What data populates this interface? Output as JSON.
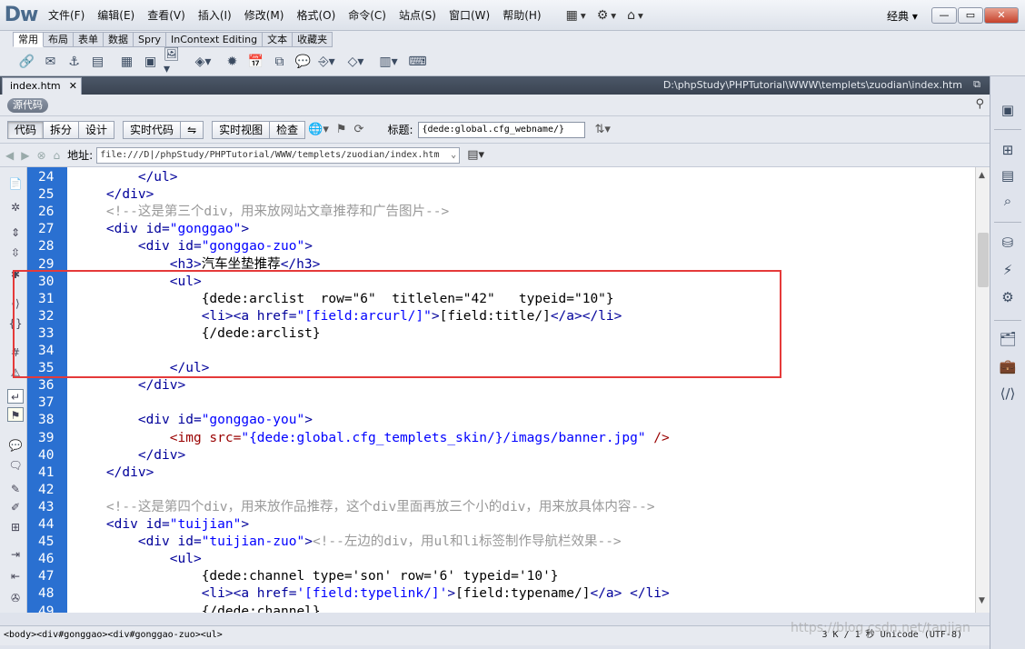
{
  "app": {
    "logo": "Dw",
    "layout": "经典 ▾"
  },
  "menu": [
    "文件(F)",
    "编辑(E)",
    "查看(V)",
    "插入(I)",
    "修改(M)",
    "格式(O)",
    "命令(C)",
    "站点(S)",
    "窗口(W)",
    "帮助(H)"
  ],
  "insert_tabs": [
    "常用",
    "布局",
    "表单",
    "数据",
    "Spry",
    "InContext Editing",
    "文本",
    "收藏夹"
  ],
  "document": {
    "tab": "index.htm",
    "path": "D:\\phpStudy\\PHPTutorial\\WWW\\templets\\zuodian\\index.htm",
    "source_label": "源代码"
  },
  "doc_toolbar": {
    "code": "代码",
    "split": "拆分",
    "design": "设计",
    "live_code": "实时代码",
    "live_view": "实时视图",
    "inspect": "检查",
    "title_label": "标题:",
    "title_value": "{dede:global.cfg_webname/}"
  },
  "address": {
    "label": "地址:",
    "value": "file:///D|/phpStudy/PHPTutorial/WWW/templets/zuodian/index.htm"
  },
  "code_lines": [
    {
      "n": "24",
      "html": "        <span class='tag'>&lt;/ul&gt;</span>"
    },
    {
      "n": "25",
      "html": "    <span class='tag'>&lt;/div&gt;</span>"
    },
    {
      "n": "26",
      "html": "    <span class='cm'>&lt;!--这是第三个div，用来放网站文章推荐和广告图片--&gt;</span>"
    },
    {
      "n": "27",
      "html": "    <span class='tag'>&lt;div </span><span class='att'>id=</span><span class='val'>\"gonggao\"</span><span class='tag'>&gt;</span>"
    },
    {
      "n": "28",
      "html": "        <span class='tag'>&lt;div </span><span class='att'>id=</span><span class='val'>\"gonggao-zuo\"</span><span class='tag'>&gt;</span>"
    },
    {
      "n": "29",
      "html": "            <span class='tag'>&lt;h3&gt;</span><span class='txt'>汽车坐垫推荐</span><span class='tag'>&lt;/h3&gt;</span>"
    },
    {
      "n": "30",
      "html": "            <span class='tag'>&lt;ul&gt;</span>"
    },
    {
      "n": "31",
      "html": "                <span class='txt'>{dede:arclist  row=\"6\"  titlelen=\"42\"   typeid=\"10\"}</span>"
    },
    {
      "n": "32",
      "html": "                <span class='tag'>&lt;li&gt;&lt;a </span><span class='att'>href=</span><span class='val'>\"[field:arcurl/]\"</span><span class='tag'>&gt;</span><span class='txt'>[field:title/]</span><span class='tag'>&lt;/a&gt;&lt;/li&gt;</span>"
    },
    {
      "n": "33",
      "html": "                <span class='txt'>{/dede:arclist}</span>"
    },
    {
      "n": "34",
      "html": ""
    },
    {
      "n": "35",
      "html": "            <span class='tag'>&lt;/ul&gt;</span>"
    },
    {
      "n": "36",
      "html": "        <span class='tag'>&lt;/div&gt;</span>"
    },
    {
      "n": "37",
      "html": ""
    },
    {
      "n": "38",
      "html": "        <span class='tag'>&lt;div </span><span class='att'>id=</span><span class='val'>\"gonggao-you\"</span><span class='tag'>&gt;</span>"
    },
    {
      "n": "39",
      "html": "            <span class='tag' style='color:#990000'>&lt;img </span><span class='att' style='color:#990000'>src=</span><span class='val'>\"{dede:global.cfg_templets_skin/}/imags/banner.jpg\"</span><span class='tag' style='color:#990000'> /&gt;</span>"
    },
    {
      "n": "40",
      "html": "        <span class='tag'>&lt;/div&gt;</span>"
    },
    {
      "n": "41",
      "html": "    <span class='tag'>&lt;/div&gt;</span>"
    },
    {
      "n": "42",
      "html": ""
    },
    {
      "n": "43",
      "html": "    <span class='cm'>&lt;!--这是第四个div，用来放作品推荐，这个div里面再放三个小的div，用来放具体内容--&gt;</span>"
    },
    {
      "n": "44",
      "html": "    <span class='tag'>&lt;div </span><span class='att'>id=</span><span class='val'>\"tuijian\"</span><span class='tag'>&gt;</span>"
    },
    {
      "n": "45",
      "html": "        <span class='tag'>&lt;div </span><span class='att'>id=</span><span class='val'>\"tuijian-zuo\"</span><span class='tag'>&gt;</span><span class='cm'>&lt;!--左边的div，用ul和li标签制作导航栏效果--&gt;</span>"
    },
    {
      "n": "46",
      "html": "            <span class='tag'>&lt;ul&gt;</span>"
    },
    {
      "n": "47",
      "html": "                <span class='txt'>{dede:channel type='son' row='6' typeid='10'}</span>"
    },
    {
      "n": "48",
      "html": "                <span class='tag'>&lt;li&gt;&lt;a </span><span class='att'>href=</span><span class='val'>'[field:typelink/]'</span><span class='tag'>&gt;</span><span class='txt'>[field:typename/]</span><span class='tag'>&lt;/a&gt; &lt;/li&gt;</span>"
    },
    {
      "n": "49",
      "html": "                <span class='txt'>{/dede:channel}</span>"
    }
  ],
  "status": {
    "breadcrumb": "<body><div#gonggao><div#gonggao-zuo><ul>",
    "info": "3 K / 1 秒  Unicode (UTF-8)",
    "watermark": "https://blog.csdn.net/tanjian"
  }
}
